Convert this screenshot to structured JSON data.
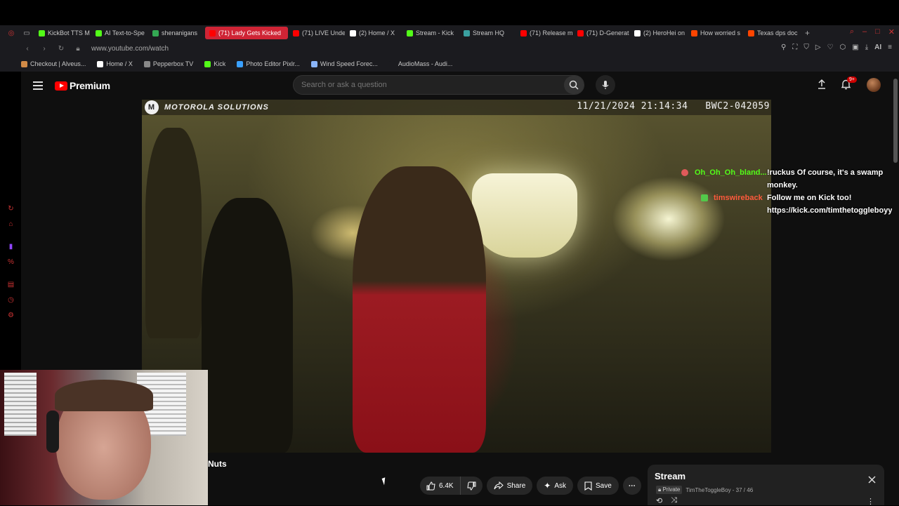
{
  "browser": {
    "tabs": [
      {
        "label": "KickBot TTS M",
        "color": "#53fc18",
        "active": false
      },
      {
        "label": "AI Text-to-Spe",
        "color": "#53fc18",
        "active": false
      },
      {
        "label": "shenanigans",
        "color": "#34a853",
        "active": false
      },
      {
        "label": "(71) Lady Gets Kicked",
        "color": "#ff0000",
        "active": true
      },
      {
        "label": "(71) LIVE Unde",
        "color": "#ff0000",
        "active": false
      },
      {
        "label": "(2) Home / X",
        "color": "#ffffff",
        "active": false
      },
      {
        "label": "Stream - Kick",
        "color": "#53fc18",
        "active": false
      },
      {
        "label": "Stream HQ",
        "color": "#3aa0a0",
        "active": false
      },
      {
        "label": "(71) Release m",
        "color": "#ff0000",
        "active": false
      },
      {
        "label": "(71) D-Generat",
        "color": "#ff0000",
        "active": false
      },
      {
        "label": "(2) HeroHei on",
        "color": "#ffffff",
        "active": false
      },
      {
        "label": "How worried s",
        "color": "#ff4500",
        "active": false
      },
      {
        "label": "Texas dps doc",
        "color": "#ff4500",
        "active": false
      }
    ],
    "new_tab": "+",
    "url": "www.youtube.com/watch",
    "ai_label": "AI",
    "bookmarks": [
      {
        "label": "Checkout | Alveus...",
        "color": "#d18b47"
      },
      {
        "label": "Home / X",
        "color": "#ffffff"
      },
      {
        "label": "Pepperbox TV",
        "color": "#888888"
      },
      {
        "label": "Kick",
        "color": "#53fc18"
      },
      {
        "label": "Photo Editor Pixlr...",
        "color": "#3aa0ff"
      },
      {
        "label": "Wind Speed Forec...",
        "color": "#8ab4f8"
      },
      {
        "label": "AudioMass - Audi...",
        "color": "#1b1b1f"
      }
    ]
  },
  "youtube": {
    "logo_text": "Premium",
    "search_placeholder": "Search or ask a question",
    "notification_count": "9+"
  },
  "video": {
    "brand": "MOTOROLA SOLUTIONS",
    "timestamp": "11/21/2024 21:14:34",
    "camera_id": "BWC2-042059",
    "title": "Nuts",
    "likes": "6.4K",
    "share_label": "Share",
    "ask_label": "Ask",
    "save_label": "Save"
  },
  "chat": [
    {
      "user": "Oh_Oh_Oh_bland...",
      "user_color": "#53fc18",
      "badge_color": "#e05a5a",
      "message_lines": [
        "!ruckus Of course, it's a swamp",
        "monkey."
      ]
    },
    {
      "user": "timswireback",
      "user_color": "#ff5a3c",
      "badge_color": "#53c84a",
      "message_lines": [
        "Follow me on Kick too!",
        "https://kick.com/timthetoggleboyy"
      ]
    }
  ],
  "playlist": {
    "title": "Stream",
    "privacy": "Private",
    "owner_progress": "TimTheToggleBoy - 37 / 46"
  }
}
